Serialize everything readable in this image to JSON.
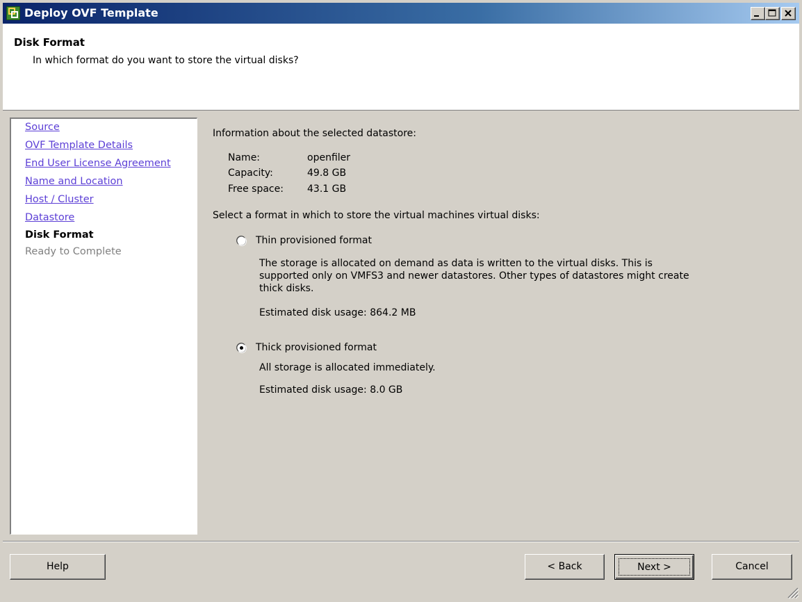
{
  "window": {
    "title": "Deploy OVF Template",
    "controls": [
      "minimize",
      "maximize",
      "close"
    ]
  },
  "header": {
    "title": "Disk Format",
    "subtitle": "In which format do you want to store the virtual disks?"
  },
  "sidebar": {
    "items": [
      {
        "label": "Source",
        "state": "link"
      },
      {
        "label": "OVF Template Details",
        "state": "link"
      },
      {
        "label": "End User License Agreement",
        "state": "link"
      },
      {
        "label": "Name and Location",
        "state": "link"
      },
      {
        "label": "Host / Cluster",
        "state": "link"
      },
      {
        "label": "Datastore",
        "state": "link"
      },
      {
        "label": "Disk Format",
        "state": "current"
      },
      {
        "label": "Ready to Complete",
        "state": "disabled"
      }
    ]
  },
  "content": {
    "info_heading": "Information about the selected datastore:",
    "datastore": {
      "name_label": "Name:",
      "name_value": "openfiler",
      "capacity_label": "Capacity:",
      "capacity_value": "49.8 GB",
      "free_label": "Free space:",
      "free_value": "43.1 GB"
    },
    "format_prompt": "Select a format in which to store the virtual machines virtual disks:",
    "options": [
      {
        "label": "Thin provisioned format",
        "selected": false,
        "description": "The storage is allocated on demand as data is written to the virtual disks. This is supported only on VMFS3 and newer datastores. Other types of datastores might create thick disks.",
        "usage": "Estimated disk usage: 864.2 MB"
      },
      {
        "label": "Thick provisioned format",
        "selected": true,
        "description": "All storage is allocated immediately.",
        "usage": "Estimated disk usage: 8.0 GB"
      }
    ]
  },
  "buttons": {
    "help": "Help",
    "back": "< Back",
    "next": "Next >",
    "cancel": "Cancel"
  },
  "colors": {
    "titlebar_start": "#0a246a",
    "titlebar_end": "#a6caf0",
    "link": "#5c3fd6",
    "face": "#d4d0c8"
  }
}
